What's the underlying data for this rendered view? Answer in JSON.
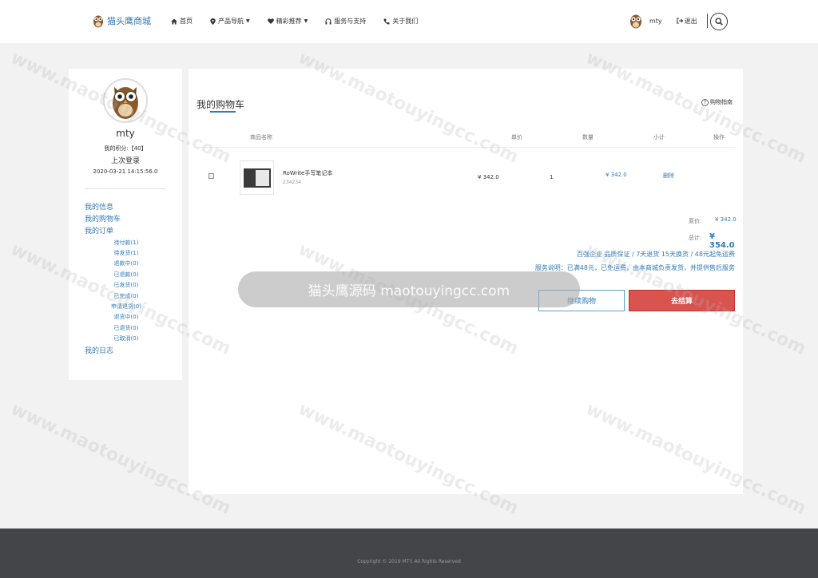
{
  "header": {
    "brand": "猫头鹰商城",
    "nav": [
      {
        "icon": "home-icon",
        "label": "首页",
        "dropdown": false
      },
      {
        "icon": "map-marker-icon",
        "label": "产品导航",
        "dropdown": true
      },
      {
        "icon": "heart-icon",
        "label": "精彩推荐",
        "dropdown": true
      },
      {
        "icon": "headphones-icon",
        "label": "服务与支持",
        "dropdown": false
      },
      {
        "icon": "phone-icon",
        "label": "关于我们",
        "dropdown": false
      }
    ],
    "user": "mty",
    "logout": "退出",
    "search_icon": "search-icon"
  },
  "sidebar": {
    "name": "mty",
    "points": "我的积分:【40】",
    "last_login_label": "上次登录",
    "last_login_time": "2020-03-21 14:15:56.0",
    "links": [
      "我的信息",
      "我的购物车",
      "我的订单"
    ],
    "order_subs": [
      "待付款(1)",
      "待发货(1)",
      "退款中(0)",
      "已退款(0)",
      "已发货(0)",
      "已完成(0)",
      "申请退货(0)",
      "退货中(0)",
      "已退货(0)",
      "已取消(0)"
    ],
    "log_link": "我的日志"
  },
  "cart": {
    "title": "我的购物车",
    "guide": "购物指南",
    "columns": {
      "name": "商品名称",
      "price": "单价",
      "qty": "数量",
      "subtotal": "小计",
      "action": "操作"
    },
    "items": [
      {
        "name": "RoWrite手写笔记本",
        "code": "234234",
        "price": "¥ 342.0",
        "qty": "1",
        "subtotal": "¥ 342.0",
        "action": "删除"
      }
    ],
    "orig_label": "原价:",
    "orig_value": "¥ 342.0",
    "total_label": "总计:",
    "total_value": "¥ 354.0",
    "promise": "百强企业 品质保证 / 7天退货 15天换货 / 48元起免运费",
    "service": "服务说明：已满48元，已免运费，由本商城负责发货，并提供售后服务",
    "continue_btn": "继续购物",
    "checkout_btn": "去结算"
  },
  "banner": "猫头鹰源码 maotouyingcc.com",
  "watermark": "www.maotouyingcc.com",
  "watermark_cn": "猫头鹰源码©",
  "footer": "Copyright © 2019 MTY. All Rights Reserved",
  "colors": {
    "link": "#337ab7",
    "checkout": "#d9534f",
    "footer": "#444548",
    "page_bg": "#f2f2f2"
  }
}
